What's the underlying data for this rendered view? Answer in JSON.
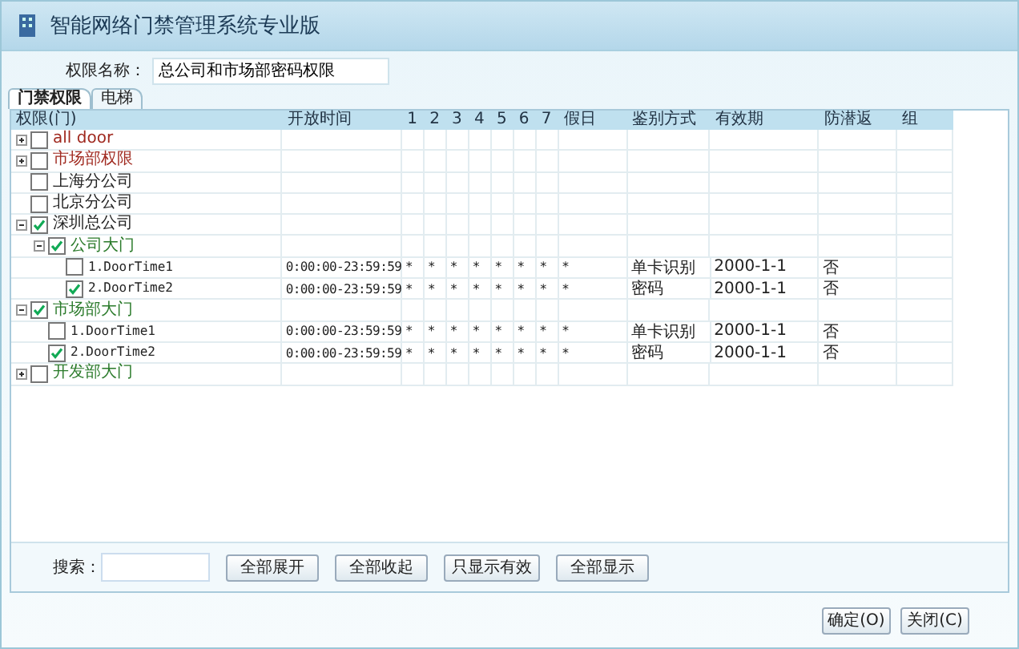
{
  "window": {
    "title": "智能网络门禁管理系统专业版"
  },
  "permission_name": {
    "label": "权限名称：",
    "value": "总公司和市场部密码权限"
  },
  "tabs": [
    {
      "label": "门禁权限",
      "selected": true
    },
    {
      "label": "电梯",
      "selected": false
    }
  ],
  "table": {
    "columns": [
      "权限(门)",
      "开放时间",
      "1",
      "2",
      "3",
      "4",
      "5",
      "6",
      "7",
      "假日",
      "鉴别方式",
      "有效期",
      "防潜返",
      "组"
    ],
    "rows": [
      {
        "kind": "permission",
        "label": "all door",
        "checked": false,
        "expanded": false
      },
      {
        "kind": "permission",
        "label": "市场部权限",
        "checked": false,
        "expanded": false
      },
      {
        "kind": "branch",
        "label": "上海分公司",
        "checked": false
      },
      {
        "kind": "branch",
        "label": "北京分公司",
        "checked": false
      },
      {
        "kind": "branch",
        "label": "深圳总公司",
        "checked": true,
        "expanded": true,
        "children": [
          {
            "kind": "door",
            "label": "公司大门",
            "checked": true,
            "expanded": true,
            "children": [
              {
                "kind": "time",
                "label": "1.DoorTime1",
                "checked": false,
                "cells": [
                  "0:00:00-23:59:59",
                  "*",
                  "*",
                  "*",
                  "*",
                  "*",
                  "*",
                  "*",
                  "*",
                  "单卡识别",
                  "2000-1-1",
                  "否"
                ]
              },
              {
                "kind": "time",
                "label": "2.DoorTime2",
                "checked": true,
                "cells": [
                  "0:00:00-23:59:59",
                  "*",
                  "*",
                  "*",
                  "*",
                  "*",
                  "*",
                  "*",
                  "*",
                  "密码",
                  "2000-1-1",
                  "否"
                ]
              }
            ]
          }
        ]
      },
      {
        "kind": "door",
        "label": "市场部大门",
        "checked": true,
        "expanded": true,
        "children": [
          {
            "kind": "time",
            "label": "1.DoorTime1",
            "checked": false,
            "cells": [
              "0:00:00-23:59:59",
              "*",
              "*",
              "*",
              "*",
              "*",
              "*",
              "*",
              "*",
              "单卡识别",
              "2000-1-1",
              "否"
            ]
          },
          {
            "kind": "time",
            "label": "2.DoorTime2",
            "checked": true,
            "cells": [
              "0:00:00-23:59:59",
              "*",
              "*",
              "*",
              "*",
              "*",
              "*",
              "*",
              "*",
              "密码",
              "2000-1-1",
              "否"
            ]
          }
        ]
      },
      {
        "kind": "door",
        "label": "开发部大门",
        "checked": false,
        "expanded": false
      }
    ]
  },
  "search": {
    "label": "搜索："
  },
  "tool_buttons": [
    "全部展开",
    "全部收起",
    "只显示有效",
    "全部显示"
  ],
  "dialog_buttons": [
    {
      "label": "确定(O)"
    },
    {
      "label": "关闭(C)"
    }
  ]
}
